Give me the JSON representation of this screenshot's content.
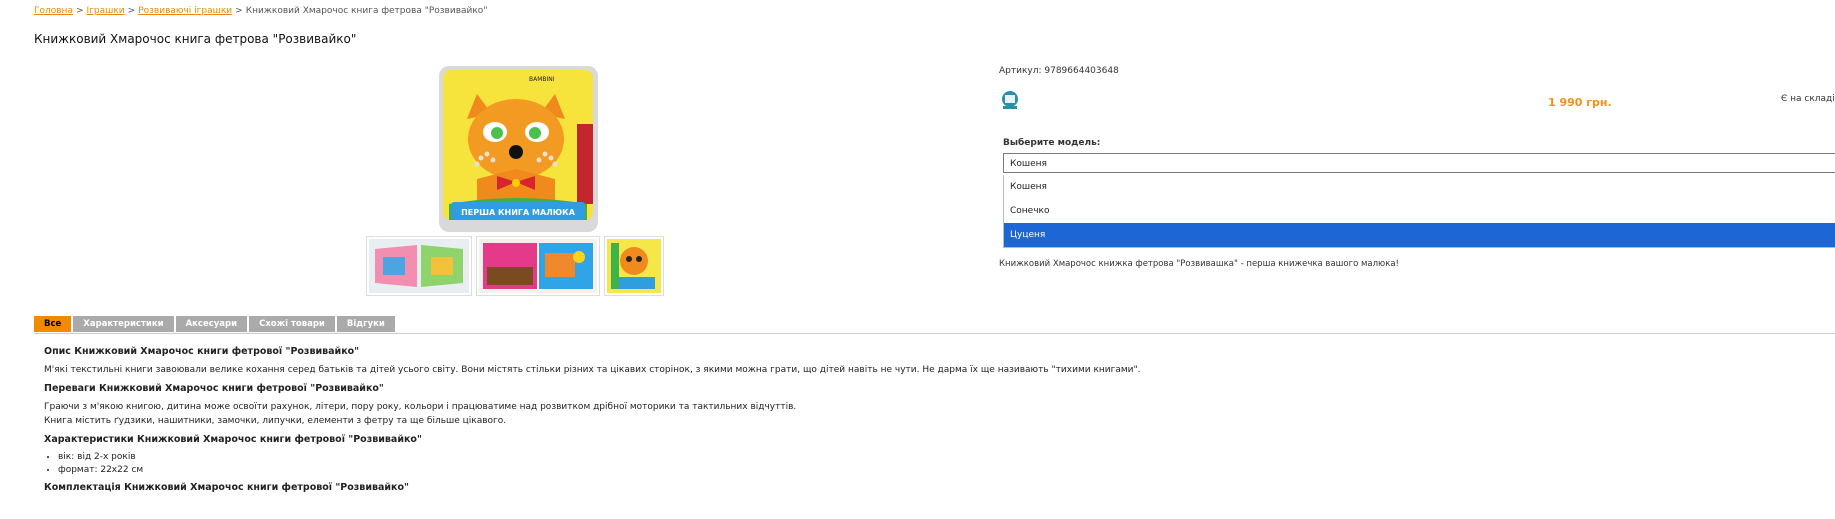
{
  "breadcrumb": {
    "home": "Головна",
    "toys": "Іграшки",
    "educational": "Розвиваючі іграшки",
    "current": "Книжковий Хмарочос книга фетрова \"Розвивайко\""
  },
  "product": {
    "title": "Книжковий Хмарочос книга фетрова \"Розвивайко\"",
    "sku": "Артикул: 9789664403648",
    "price": "1 990 грн.",
    "stock": "Є на складі",
    "short_description": "Книжковий Хмарочос книжка фетрова \"Розвивашка\" - перша книжечка вашого малюка!",
    "image": {
      "brand_text": "BAMBINI",
      "cover_text": "ПЕРША КНИГА МАЛЮКА"
    }
  },
  "model_select": {
    "label": "Выберите модель:",
    "value": "Кошеня",
    "options": [
      "Кошеня",
      "Сонечко",
      "Цуценя"
    ],
    "selected_index": 2
  },
  "tabs": [
    "Все",
    "Характеристики",
    "Аксесуари",
    "Схожі товари",
    "Відгуки"
  ],
  "content": {
    "h1": "Опис Книжковий Хмарочос книги фетрової \"Розвивайко\"",
    "p1": "М'які текстильні книги завоювали велике кохання серед батьків та дітей усього світу. Вони містять стільки різних та цікавих сторінок, з якими можна грати, що дітей навіть не чути. Не дарма їх ще називають \"тихими книгами\".",
    "h2": "Переваги Книжковий Хмарочос книги фетрової \"Розвивайко\"",
    "p2a": "Граючи з м'якою книгою, дитина може освоїти рахунок, літери, пору року, кольори і працюватиме над розвитком дрібної моторики та тактильних відчуттів.",
    "p2b": "Книга містить ґудзики, нашитники, замочки, липучки, елементи з фетру та ще більше цікавого.",
    "h3": "Характеристики Книжковий Хмарочос книги фетрової \"Розвивайко\"",
    "li1": "вік: від 2-х років",
    "li2": "формат: 22х22 см",
    "h4": "Комплектація Книжковий Хмарочос книги фетрової \"Розвивайко\""
  },
  "colors": {
    "accent": "#f28a00",
    "price": "#f3901e",
    "link": "#e8890c",
    "selected": "#1c66d6"
  }
}
